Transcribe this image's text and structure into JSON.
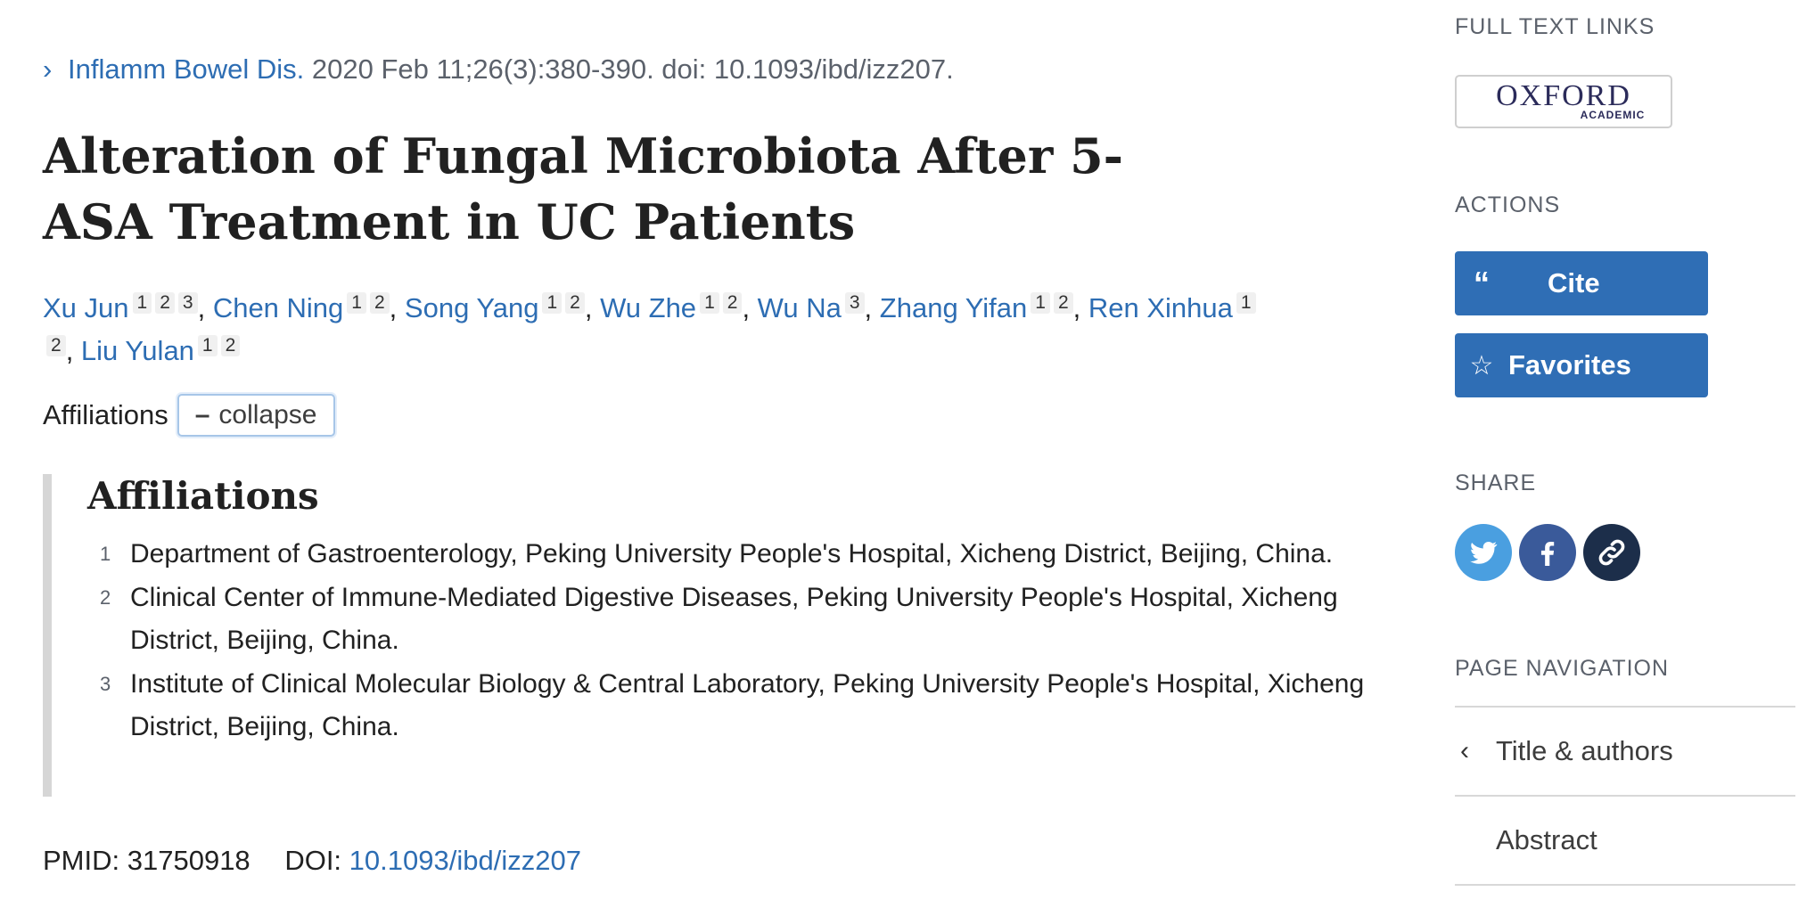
{
  "citation": {
    "journal": "Inflamm Bowel Dis.",
    "details": "2020 Feb 11;26(3):380-390. doi: 10.1093/ibd/izz207."
  },
  "title": "Alteration of Fungal Microbiota After 5-ASA Treatment in UC Patients",
  "authors": [
    {
      "name": "Xu Jun",
      "affils": [
        "1",
        "2",
        "3"
      ]
    },
    {
      "name": "Chen Ning",
      "affils": [
        "1",
        "2"
      ]
    },
    {
      "name": "Song Yang",
      "affils": [
        "1",
        "2"
      ]
    },
    {
      "name": "Wu Zhe",
      "affils": [
        "1",
        "2"
      ]
    },
    {
      "name": "Wu Na",
      "affils": [
        "3"
      ]
    },
    {
      "name": "Zhang Yifan",
      "affils": [
        "1",
        "2"
      ]
    },
    {
      "name": "Ren Xinhua",
      "affils": [
        "1",
        "2"
      ]
    },
    {
      "name": "Liu Yulan",
      "affils": [
        "1",
        "2"
      ]
    }
  ],
  "affiliations_toggle": {
    "label": "Affiliations",
    "button": "collapse",
    "button_symbol": "–"
  },
  "affiliations": {
    "heading": "Affiliations",
    "items": [
      {
        "num": "1",
        "text": "Department of Gastroenterology, Peking University People's Hospital, Xicheng District, Beijing, China."
      },
      {
        "num": "2",
        "text": "Clinical Center of Immune-Mediated Digestive Diseases, Peking University People's Hospital, Xicheng District, Beijing, China."
      },
      {
        "num": "3",
        "text": "Institute of Clinical Molecular Biology & Central Laboratory, Peking University People's Hospital, Xicheng District, Beijing, China."
      }
    ]
  },
  "ids": {
    "pmid_label": "PMID:",
    "pmid": "31750918",
    "doi_label": "DOI:",
    "doi": "10.1093/ibd/izz207"
  },
  "sidebar": {
    "full_text_heading": "FULL TEXT LINKS",
    "publisher": {
      "name": "OXFORD",
      "sub": "ACADEMIC"
    },
    "actions_heading": "ACTIONS",
    "cite_label": "Cite",
    "favorites_label": "Favorites",
    "share_heading": "SHARE",
    "share": [
      {
        "icon": "twitter-icon",
        "color": "#4a9fe0"
      },
      {
        "icon": "facebook-icon",
        "color": "#3a5a9a"
      },
      {
        "icon": "link-icon",
        "color": "#1c2e4a"
      }
    ],
    "page_nav_heading": "PAGE NAVIGATION",
    "nav_items": [
      {
        "label": "Title & authors",
        "chevron": "‹"
      },
      {
        "label": "Abstract",
        "chevron": ""
      }
    ]
  },
  "colors": {
    "link": "#2d6db3",
    "button": "#2f6eb5"
  }
}
